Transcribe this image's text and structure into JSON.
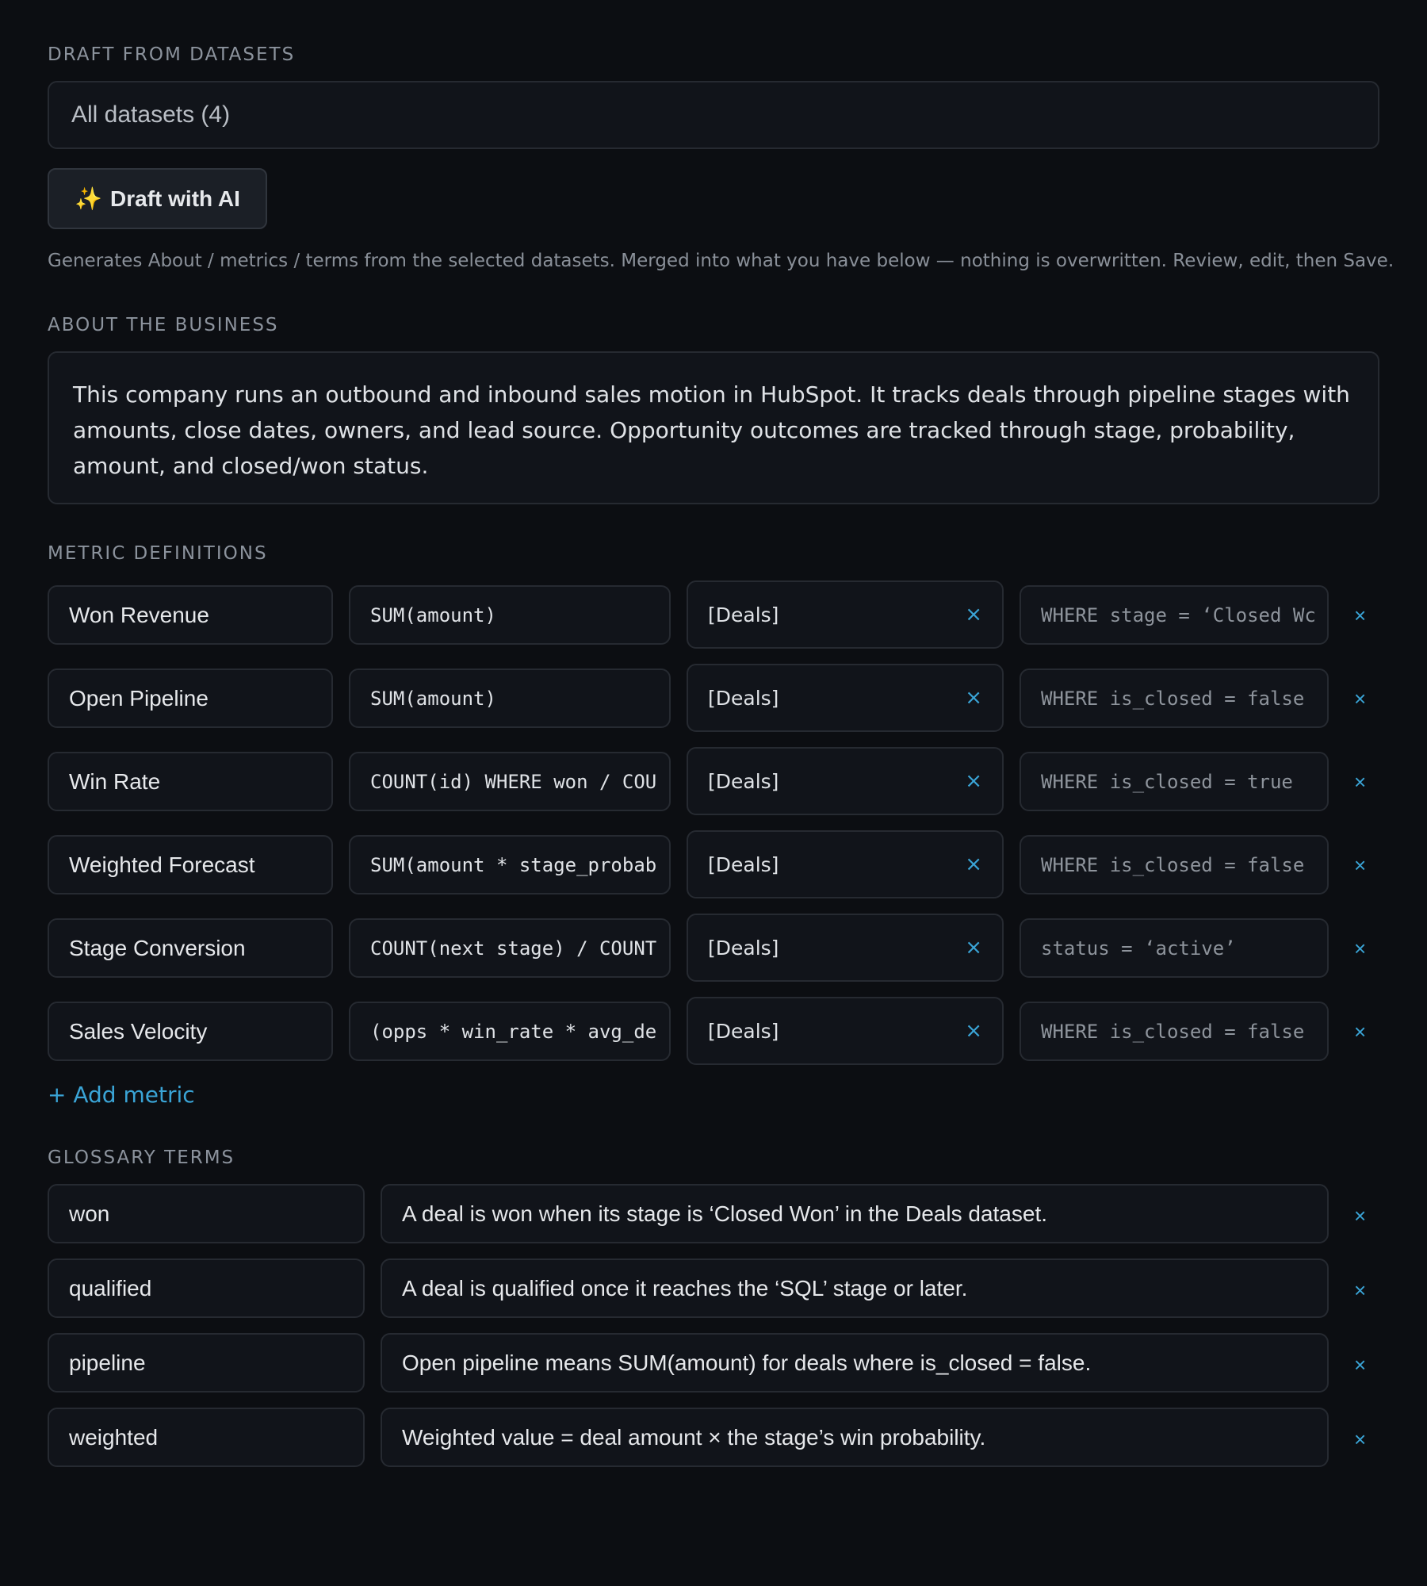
{
  "draft": {
    "label": "DRAFT FROM DATASETS",
    "dataset_select": "All datasets (4)",
    "ai_button_icon": "✨",
    "ai_button_label": "Draft with AI",
    "helper_text": "Generates About / metrics / terms from the selected datasets. Merged into what you have below — nothing is overwritten. Review, edit, then Save."
  },
  "about": {
    "label": "ABOUT THE BUSINESS",
    "text": "This company runs an outbound and inbound sales motion in HubSpot. It tracks deals through pipeline stages with amounts, close dates, owners, and lead source. Opportunity outcomes are tracked through stage, probability, amount, and closed/won status."
  },
  "metrics": {
    "label": "METRIC DEFINITIONS",
    "add_label": "+ Add metric",
    "remove_glyph": "×",
    "rows": [
      {
        "name": "Won Revenue",
        "expr": "SUM(amount)",
        "dataset": "[Deals]",
        "filter": "WHERE stage = ‘Closed Wc"
      },
      {
        "name": "Open Pipeline",
        "expr": "SUM(amount)",
        "dataset": "[Deals]",
        "filter": "WHERE is_closed = false"
      },
      {
        "name": "Win Rate",
        "expr": "COUNT(id) WHERE won / COU",
        "dataset": "[Deals]",
        "filter": "WHERE is_closed = true"
      },
      {
        "name": "Weighted Forecast",
        "expr": "SUM(amount * stage_probab",
        "dataset": "[Deals]",
        "filter": "WHERE is_closed = false"
      },
      {
        "name": "Stage Conversion",
        "expr": "COUNT(next stage) / COUNT",
        "dataset": "[Deals]",
        "filter": "status = ‘active’"
      },
      {
        "name": "Sales Velocity",
        "expr": "(opps * win_rate * avg_de",
        "dataset": "[Deals]",
        "filter": "WHERE is_closed = false"
      }
    ]
  },
  "glossary": {
    "label": "GLOSSARY TERMS",
    "rows": [
      {
        "term": "won",
        "definition": "A deal is won when its stage is ‘Closed Won’ in the Deals dataset."
      },
      {
        "term": "qualified",
        "definition": "A deal is qualified once it reaches the ‘SQL’ stage or later."
      },
      {
        "term": "pipeline",
        "definition": "Open pipeline means SUM(amount) for deals where is_closed = false."
      },
      {
        "term": "weighted",
        "definition": "Weighted value = deal amount × the stage’s win probability."
      }
    ]
  }
}
